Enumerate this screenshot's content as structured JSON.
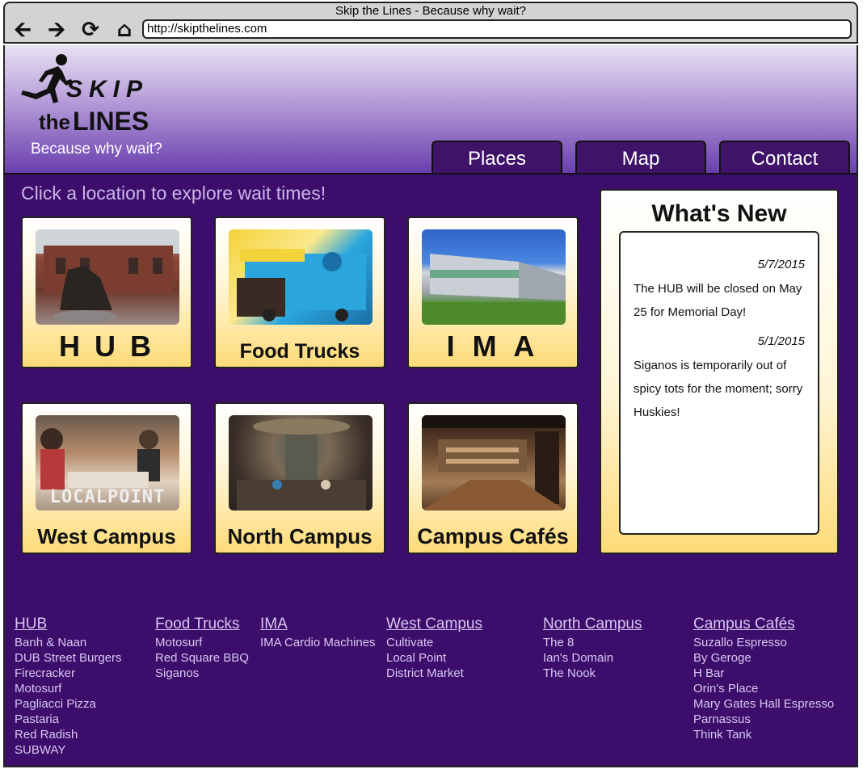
{
  "browser": {
    "title": "Skip the Lines - Because why wait?",
    "url": "http://skipthelines.com",
    "icons": [
      "back-arrow-icon",
      "forward-arrow-icon",
      "refresh-icon",
      "home-icon"
    ]
  },
  "header": {
    "logo": {
      "skip": "SKIP",
      "the": "the",
      "lines": "LINES"
    },
    "tagline": "Because why wait?",
    "nav": {
      "places": "Places",
      "map": "Map",
      "contact": "Contact"
    }
  },
  "main": {
    "intro": "Click a location to explore wait times!",
    "cards": {
      "hub": "H U B",
      "food_trucks": "Food Trucks",
      "ima": "I M A",
      "west_campus": "West Campus",
      "localpoint_caption": "LOCALPOINT",
      "north_campus": "North Campus",
      "campus_cafes": "Campus Cafés"
    }
  },
  "news": {
    "title": "What's New",
    "items": [
      {
        "date": "5/7/2015",
        "text": "The HUB will be closed on May 25 for Memorial Day!"
      },
      {
        "date": "5/1/2015",
        "text": "Siganos is temporarily out of spicy tots for the moment; sorry Huskies!"
      }
    ]
  },
  "footer": {
    "columns": [
      {
        "heading": "HUB",
        "items": [
          "Banh & Naan",
          "DUB Street Burgers",
          "Firecracker",
          "Motosurf",
          "Pagliacci Pizza",
          "Pastaria",
          "Red Radish",
          "SUBWAY"
        ]
      },
      {
        "heading": "Food Trucks",
        "items": [
          "Motosurf",
          "Red Square BBQ",
          "Siganos"
        ]
      },
      {
        "heading": "IMA",
        "items": [
          "IMA Cardio Machines"
        ]
      },
      {
        "heading": "West Campus",
        "items": [
          "Cultivate",
          "Local Point",
          "District Market"
        ]
      },
      {
        "heading": "North Campus",
        "items": [
          "The 8",
          "Ian's Domain",
          "The Nook"
        ]
      },
      {
        "heading": "Campus Cafés",
        "items": [
          "Suzallo Espresso",
          "By Geroge",
          "H Bar",
          "Orin's Place",
          "Mary Gates Hall Espresso",
          "Parnassus",
          "Think Tank"
        ]
      }
    ]
  },
  "colors": {
    "main_bg": "#3d0d6b",
    "nav_bg": "#3f1368",
    "card_gradient_end": "#fddb78",
    "footer_text": "#d8c8f2"
  }
}
